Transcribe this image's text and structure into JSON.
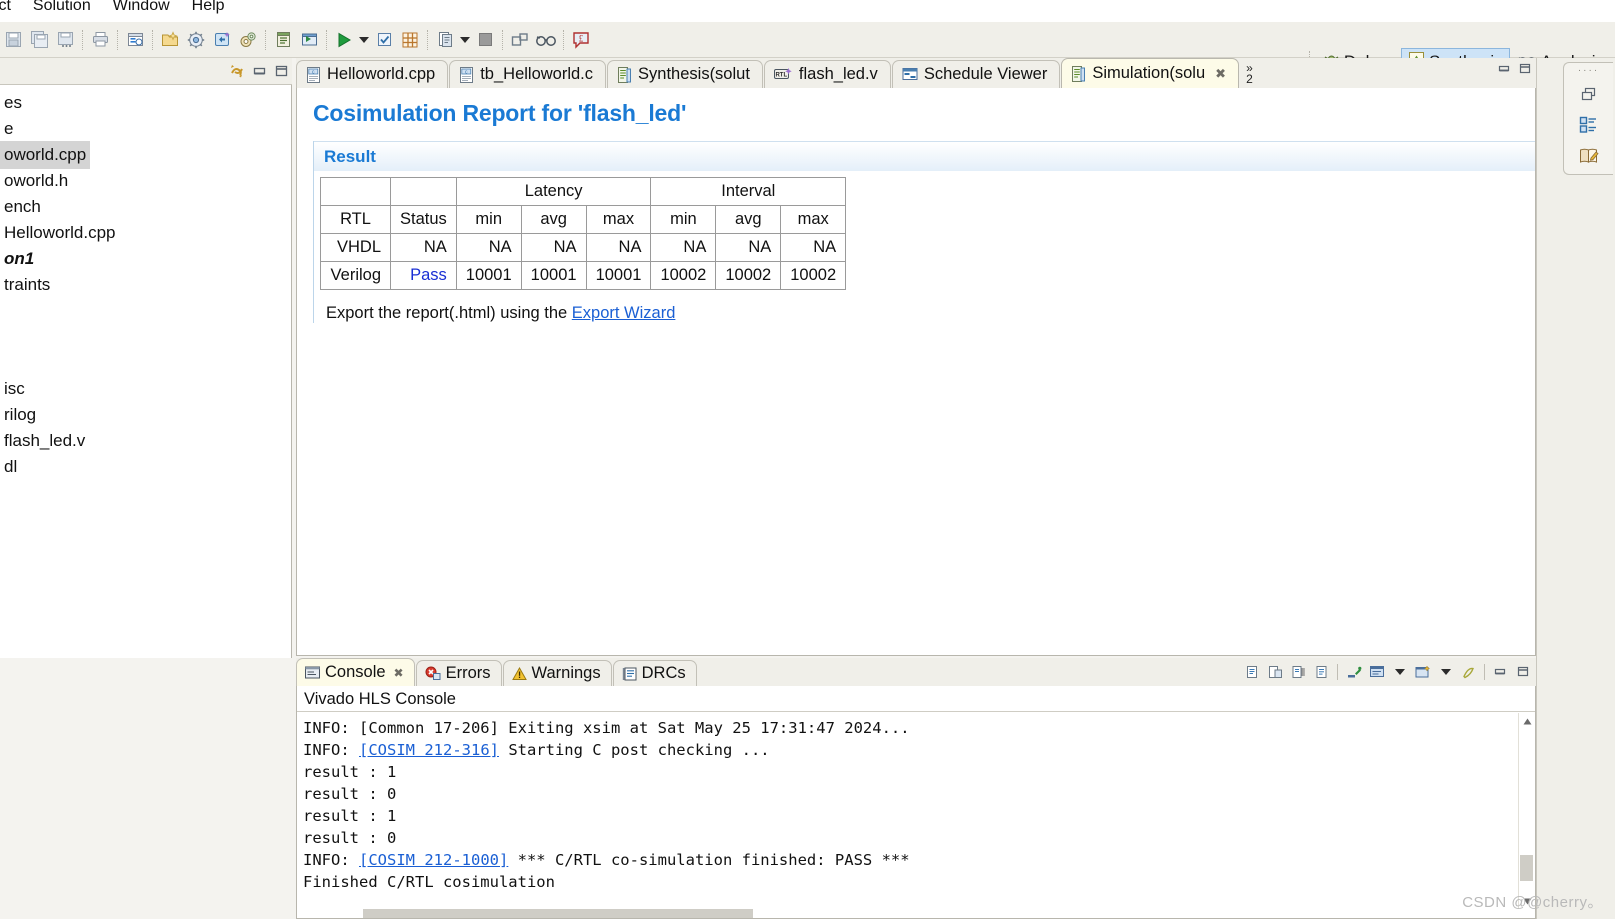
{
  "menu": {
    "items": [
      "ject",
      "Solution",
      "Window",
      "Help"
    ]
  },
  "toolbar": {
    "buttons": [
      {
        "name": "save-button",
        "icon": "save-icon"
      },
      {
        "name": "save-all-button",
        "icon": "save-all-icon"
      },
      {
        "name": "save-as-button",
        "icon": "save-as-icon"
      },
      {
        "name": "print-button",
        "icon": "print-icon"
      },
      {
        "name": "project-settings-button",
        "icon": "project-settings-icon"
      },
      {
        "name": "new-project-button",
        "icon": "new-project-icon"
      },
      {
        "name": "solution-settings-button",
        "icon": "gear-icon"
      },
      {
        "name": "new-solution-button",
        "icon": "new-solution-icon"
      },
      {
        "name": "run-settings-button",
        "icon": "gears-icon"
      },
      {
        "name": "run-c-simulation-button",
        "icon": "c-simulation-icon"
      },
      {
        "name": "run-c-synthesis-button",
        "icon": "c-synthesis-icon"
      },
      {
        "name": "run-button",
        "icon": "run-play-icon"
      },
      {
        "name": "run-dropdown",
        "icon": "chevron-down-icon"
      },
      {
        "name": "run-cosimulation-button",
        "icon": "cosimulation-check-icon"
      },
      {
        "name": "export-rtl-button",
        "icon": "export-rtl-grid-icon"
      },
      {
        "name": "compare-reports-button",
        "icon": "compare-reports-icon"
      },
      {
        "name": "compare-dropdown",
        "icon": "chevron-down-icon"
      },
      {
        "name": "stop-button",
        "icon": "stop-square-icon"
      },
      {
        "name": "open-report-button",
        "icon": "open-report-icon"
      },
      {
        "name": "analysis-view-button",
        "icon": "glasses-icon"
      },
      {
        "name": "currency-button",
        "icon": "pound-bubble-icon"
      }
    ]
  },
  "perspectives": {
    "items": [
      {
        "label": "Debug",
        "icon": "debug-bug-icon",
        "active": false
      },
      {
        "label": "Synthesis",
        "icon": "synthesis-icon",
        "active": true
      },
      {
        "label": "Analysis",
        "icon": "glasses-icon",
        "active": false
      }
    ]
  },
  "explorer": {
    "title_icons": [
      "link-with-editor-icon",
      "minimize-icon",
      "maximize-icon"
    ],
    "rows": [
      {
        "label": "es",
        "style": "normal"
      },
      {
        "label": "e",
        "style": "normal"
      },
      {
        "label": "oworld.cpp",
        "style": "selected"
      },
      {
        "label": "oworld.h",
        "style": "normal"
      },
      {
        "label": "ench",
        "style": "normal"
      },
      {
        "label": "Helloworld.cpp",
        "style": "normal"
      },
      {
        "label": "on1",
        "style": "bolditalic"
      },
      {
        "label": "traints",
        "style": "normal"
      },
      {
        "label": "",
        "style": "blue"
      },
      {
        "label": "",
        "style": "blue"
      },
      {
        "label": "",
        "style": "normal"
      },
      {
        "label": "isc",
        "style": "normal"
      },
      {
        "label": "rilog",
        "style": "normal"
      },
      {
        "label": "flash_led.v",
        "style": "normal"
      },
      {
        "label": "dl",
        "style": "normal"
      }
    ]
  },
  "editor": {
    "tabs": [
      {
        "label": "Helloworld.cpp",
        "icon": "c-file-icon",
        "active": false,
        "closable": false
      },
      {
        "label": "tb_Helloworld.c",
        "icon": "c-file-icon",
        "active": false,
        "closable": false
      },
      {
        "label": "Synthesis(solut",
        "icon": "report-icon",
        "active": false,
        "closable": false
      },
      {
        "label": "flash_led.v",
        "icon": "rtl-file-icon",
        "active": false,
        "closable": false
      },
      {
        "label": "Schedule Viewer",
        "icon": "schedule-viewer-icon",
        "active": false,
        "closable": false
      },
      {
        "label": "Simulation(solu",
        "icon": "report-icon",
        "active": true,
        "closable": true
      }
    ],
    "overflow_chevron": "»",
    "overflow_count": "2",
    "frame_buttons": [
      "minimize-icon",
      "maximize-icon"
    ]
  },
  "report": {
    "title": "Cosimulation Report for 'flash_led'",
    "section_title": "Result",
    "table": {
      "group_headers": [
        "",
        "",
        "Latency",
        "Interval"
      ],
      "column_headers": [
        "RTL",
        "Status",
        "min",
        "avg",
        "max",
        "min",
        "avg",
        "max"
      ],
      "rows": [
        {
          "rtl": "VHDL",
          "status": "NA",
          "latency_min": "NA",
          "latency_avg": "NA",
          "latency_max": "NA",
          "interval_min": "NA",
          "interval_avg": "NA",
          "interval_max": "NA",
          "status_pass": false
        },
        {
          "rtl": "Verilog",
          "status": "Pass",
          "latency_min": "10001",
          "latency_avg": "10001",
          "latency_max": "10001",
          "interval_min": "10002",
          "interval_avg": "10002",
          "interval_max": "10002",
          "status_pass": true
        }
      ]
    },
    "export_text": "Export the report(.html) using the ",
    "export_link": "Export Wizard"
  },
  "console": {
    "tabs": [
      {
        "label": "Console",
        "icon": "console-icon",
        "active": true,
        "closable": true
      },
      {
        "label": "Errors",
        "icon": "error-icon",
        "active": false,
        "closable": false
      },
      {
        "label": "Warnings",
        "icon": "warning-icon",
        "active": false,
        "closable": false
      },
      {
        "label": "DRCs",
        "icon": "drc-icon",
        "active": false,
        "closable": false
      }
    ],
    "toolbar_icons": [
      "copy-output-icon",
      "paste-icon",
      "terminate-output-icon",
      "clear-console-icon",
      "scroll-lock-icon",
      "display-selected-console-icon",
      "minus-icon",
      "open-console-icon",
      "minus-icon-2",
      "pin-console-icon"
    ],
    "frame_buttons": [
      "minimize-icon",
      "maximize-icon"
    ],
    "header": "Vivado HLS Console",
    "lines": [
      {
        "text": "INFO: [Common 17-206] Exiting xsim at Sat May 25 17:31:47 2024...",
        "link": null
      },
      {
        "prefix": "INFO: ",
        "link": "[COSIM 212-316]",
        "suffix": " Starting C post checking ..."
      },
      {
        "text": "result : 1",
        "link": null
      },
      {
        "text": "result : 0",
        "link": null
      },
      {
        "text": "result : 1",
        "link": null
      },
      {
        "text": "result : 0",
        "link": null
      },
      {
        "prefix": "INFO: ",
        "link": "[COSIM 212-1000]",
        "suffix": " *** C/RTL co-simulation finished: PASS ***"
      },
      {
        "text": "Finished C/RTL cosimulation",
        "link": null
      }
    ]
  },
  "right_bar": {
    "icons": [
      "restore-icon",
      "outline-view-icon",
      "editor-notes-icon"
    ]
  },
  "watermark": "CSDN @@cherry。",
  "colors": {
    "accent_blue": "#1a7ad4",
    "link_blue": "#1a5fd4",
    "pass_blue": "#1a2fd4",
    "active_tab": "#fdfbe8",
    "toolbar_bg": "#f0efe9",
    "selection_gray": "#d4d4d4"
  }
}
